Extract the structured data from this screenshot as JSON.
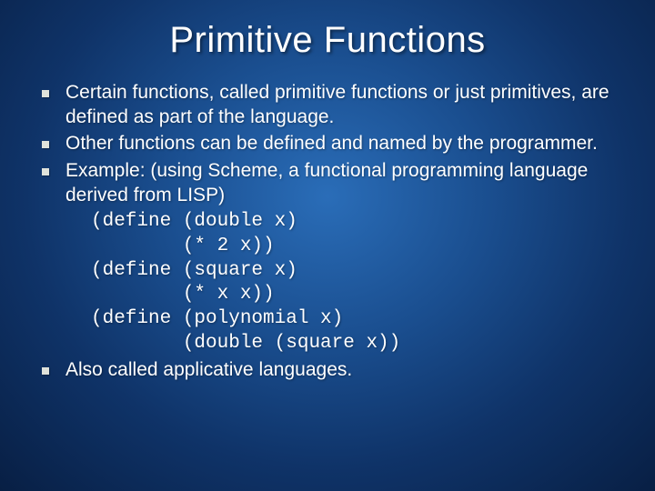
{
  "title": "Primitive Functions",
  "bullets": {
    "b1": "Certain functions, called primitive functions or just primitives, are defined as part of the language.",
    "b2": "Other functions can be defined and named by the programmer.",
    "b3": "Example: (using Scheme, a functional programming language derived from LISP)",
    "b4": "Also called applicative languages."
  },
  "code": "(define (double x)\n        (* 2 x))\n(define (square x)\n        (* x x))\n(define (polynomial x)\n        (double (square x))"
}
